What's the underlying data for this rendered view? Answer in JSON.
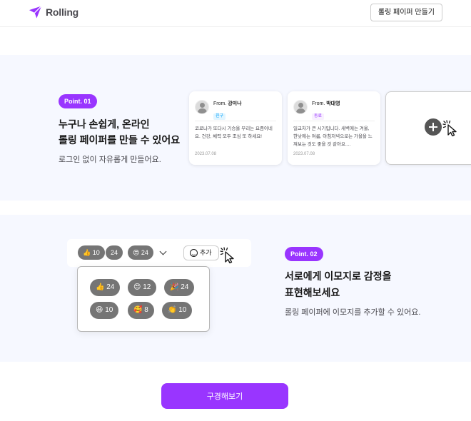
{
  "header": {
    "brand": "Rolling",
    "create_button": "롤링 페이퍼 만들기",
    "brand_color": "#9935ff"
  },
  "point1": {
    "badge": "Point. 01",
    "title_line1": "누구나 손쉽게, 온라인",
    "title_line2": "롤링 페이퍼를 만들 수 있어요",
    "description": "로그인 없이 자유롭게 만들어요.",
    "cards": [
      {
        "from_prefix": "From.",
        "name": "강미나",
        "relationship": "친구",
        "message": "코로나가 또다시 기승을 부리는 요즘이네요. 건강, 체력 모두 조심 또 하세요!",
        "date": "2023.07.08"
      },
      {
        "from_prefix": "From.",
        "name": "박대영",
        "relationship": "동료",
        "message": "일교차가 큰 시기입니다. 새벽에는 겨울, 한낮에는 여름, 아침저녁으로는 가을을 느껴보는 것도 좋을 것 같아요....",
        "date": "2023.07.08"
      }
    ],
    "add_card_icon": "plus-circle-icon"
  },
  "point2": {
    "badge": "Point. 02",
    "title_line1": "서로에게 이모지로 감정을",
    "title_line2": "표현해보세요",
    "description": "롤링 페이퍼에 이모지를 추가할 수 있어요.",
    "top_reactions": [
      {
        "emoji": "👍",
        "count": "10"
      },
      {
        "emoji": "",
        "count": "24"
      },
      {
        "emoji": "😍",
        "count": "24"
      }
    ],
    "add_label": "추가",
    "panel_reactions": [
      {
        "emoji": "👍",
        "count": "24"
      },
      {
        "emoji": "😍",
        "count": "12"
      },
      {
        "emoji": "🎉",
        "count": "24"
      },
      {
        "emoji": "😆",
        "count": "10"
      },
      {
        "emoji": "🥰",
        "count": "8"
      },
      {
        "emoji": "👏",
        "count": "10"
      }
    ]
  },
  "cta": {
    "label": "구경해보기"
  }
}
